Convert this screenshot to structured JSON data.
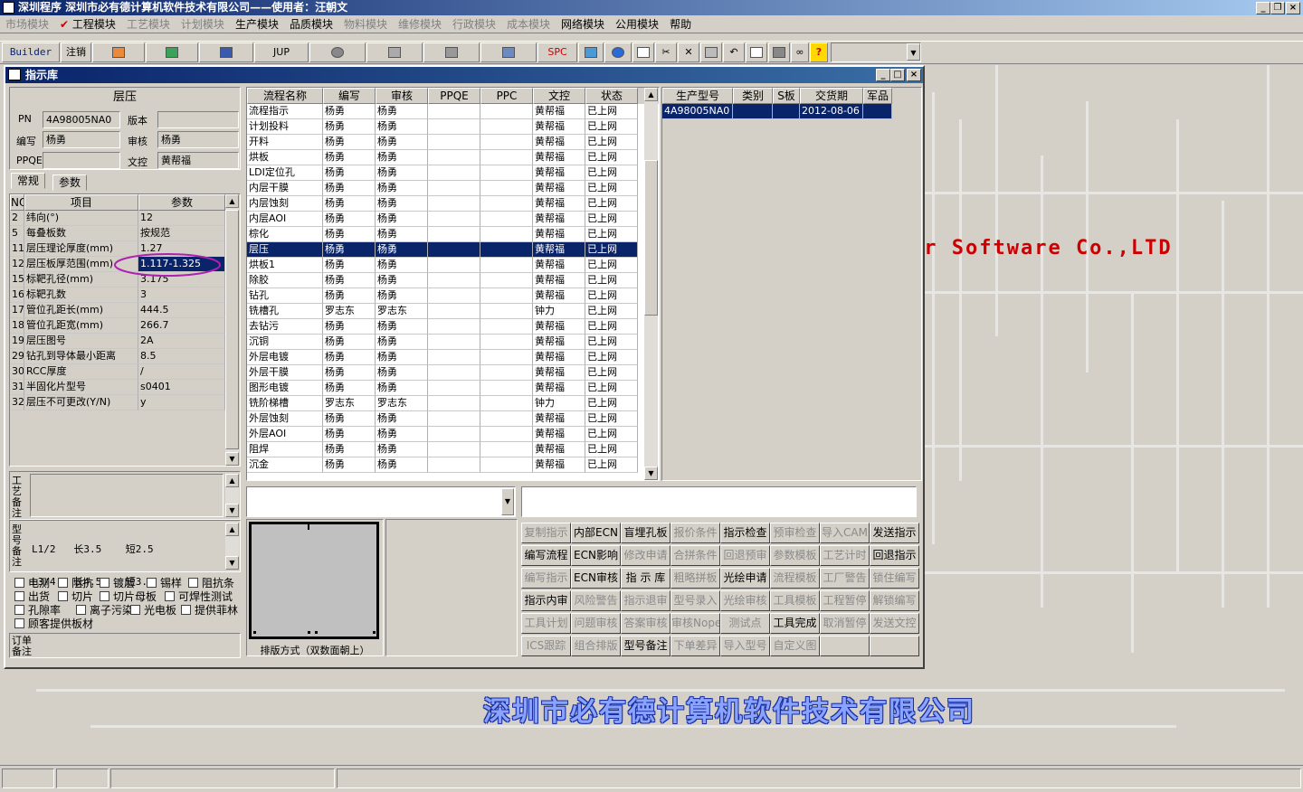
{
  "window": {
    "title": "深圳程序   深圳市必有德计算机软件技术有限公司——使用者：汪朝文"
  },
  "menu": [
    {
      "label": "市场模块",
      "enabled": false
    },
    {
      "label": "工程模块",
      "enabled": true,
      "checked": true
    },
    {
      "label": "工艺模块",
      "enabled": false
    },
    {
      "label": "计划模块",
      "enabled": false
    },
    {
      "label": "生产模块",
      "enabled": true
    },
    {
      "label": "品质模块",
      "enabled": true
    },
    {
      "label": "物料模块",
      "enabled": false
    },
    {
      "label": "维修模块",
      "enabled": false
    },
    {
      "label": "行政模块",
      "enabled": false
    },
    {
      "label": "成本模块",
      "enabled": false
    },
    {
      "label": "网络模块",
      "enabled": true
    },
    {
      "label": "公用模块",
      "enabled": true
    },
    {
      "label": "帮助",
      "enabled": true
    }
  ],
  "toolbar": {
    "builder": "Builder",
    "logout": "注销",
    "jup": "JUP",
    "spc": "SPC"
  },
  "background": {
    "brand_en": "er Software Co.,LTD",
    "brand_cn": "深圳市必有德计算机软件技术有限公司"
  },
  "child": {
    "title": "指示库"
  },
  "info": {
    "process_name": "层压",
    "pn_label": "PN",
    "pn_value": "4A98005NA0",
    "version_label": "版本",
    "version_value": "",
    "editor_label": "编写",
    "editor_value": "杨勇",
    "reviewer_label": "审核",
    "reviewer_value": "杨勇",
    "ppqe_label": "PPQE",
    "ppqe_value": "",
    "doc_label": "文控",
    "doc_value": "黄帮福"
  },
  "tabs": [
    "常规",
    "参数"
  ],
  "params": {
    "headers": [
      "NO",
      "项目",
      "参数"
    ],
    "rows": [
      [
        "2",
        "纬向(°)",
        "12"
      ],
      [
        "5",
        "每叠板数",
        "按规范"
      ],
      [
        "11",
        "层压理论厚度(mm)",
        "1.27"
      ],
      [
        "12",
        "层压板厚范围(mm)",
        "1.117-1.325"
      ],
      [
        "15",
        "标靶孔径(mm)",
        "3.175"
      ],
      [
        "16",
        "标靶孔数",
        "3"
      ],
      [
        "17",
        "管位孔距长(mm)",
        "444.5"
      ],
      [
        "18",
        "管位孔距宽(mm)",
        "266.7"
      ],
      [
        "19",
        "层压图号",
        "2A"
      ],
      [
        "29",
        "钻孔到导体最小距离",
        "8.5"
      ],
      [
        "30",
        "RCC厚度",
        "/"
      ],
      [
        "31",
        "半固化片型号",
        "s0401"
      ],
      [
        "32",
        "层压不可更改(Y/N)",
        "y"
      ]
    ]
  },
  "remarks": {
    "process_label": "工艺备注",
    "model_label": "型号备注",
    "model_text": [
      "L1/2   长3.5    短2.5",
      "L3/4   长4.5    短3.5"
    ],
    "order_label": "订单备注"
  },
  "checkboxes": [
    [
      "电测",
      "阻抗",
      "镀层",
      "锡样",
      "阻抗条"
    ],
    [
      "出货",
      "切片",
      "切片母板",
      "可焊性测试"
    ],
    [
      "孔隙率",
      "离子污染",
      "光电板",
      "提供菲林"
    ],
    [
      "顾客提供板材"
    ]
  ],
  "flows": {
    "headers": [
      "流程名称",
      "编写",
      "审核",
      "PPQE",
      "PPC",
      "文控",
      "状态"
    ],
    "rows": [
      [
        "流程指示",
        "杨勇",
        "杨勇",
        "",
        "",
        "黄帮福",
        "已上网"
      ],
      [
        "计划投料",
        "杨勇",
        "杨勇",
        "",
        "",
        "黄帮福",
        "已上网"
      ],
      [
        "开料",
        "杨勇",
        "杨勇",
        "",
        "",
        "黄帮福",
        "已上网"
      ],
      [
        "烘板",
        "杨勇",
        "杨勇",
        "",
        "",
        "黄帮福",
        "已上网"
      ],
      [
        "LDI定位孔",
        "杨勇",
        "杨勇",
        "",
        "",
        "黄帮福",
        "已上网"
      ],
      [
        "内层干膜",
        "杨勇",
        "杨勇",
        "",
        "",
        "黄帮福",
        "已上网"
      ],
      [
        "内层蚀刻",
        "杨勇",
        "杨勇",
        "",
        "",
        "黄帮福",
        "已上网"
      ],
      [
        "内层AOI",
        "杨勇",
        "杨勇",
        "",
        "",
        "黄帮福",
        "已上网"
      ],
      [
        "棕化",
        "杨勇",
        "杨勇",
        "",
        "",
        "黄帮福",
        "已上网"
      ],
      [
        "层压",
        "杨勇",
        "杨勇",
        "",
        "",
        "黄帮福",
        "已上网"
      ],
      [
        "烘板1",
        "杨勇",
        "杨勇",
        "",
        "",
        "黄帮福",
        "已上网"
      ],
      [
        "除胶",
        "杨勇",
        "杨勇",
        "",
        "",
        "黄帮福",
        "已上网"
      ],
      [
        "钻孔",
        "杨勇",
        "杨勇",
        "",
        "",
        "黄帮福",
        "已上网"
      ],
      [
        "铣槽孔",
        "罗志东",
        "罗志东",
        "",
        "",
        "钟力",
        "已上网"
      ],
      [
        "去钻污",
        "杨勇",
        "杨勇",
        "",
        "",
        "黄帮福",
        "已上网"
      ],
      [
        "沉铜",
        "杨勇",
        "杨勇",
        "",
        "",
        "黄帮福",
        "已上网"
      ],
      [
        "外层电镀",
        "杨勇",
        "杨勇",
        "",
        "",
        "黄帮福",
        "已上网"
      ],
      [
        "外层干膜",
        "杨勇",
        "杨勇",
        "",
        "",
        "黄帮福",
        "已上网"
      ],
      [
        "图形电镀",
        "杨勇",
        "杨勇",
        "",
        "",
        "黄帮福",
        "已上网"
      ],
      [
        "铣阶梯槽",
        "罗志东",
        "罗志东",
        "",
        "",
        "钟力",
        "已上网"
      ],
      [
        "外层蚀刻",
        "杨勇",
        "杨勇",
        "",
        "",
        "黄帮福",
        "已上网"
      ],
      [
        "外层AOI",
        "杨勇",
        "杨勇",
        "",
        "",
        "黄帮福",
        "已上网"
      ],
      [
        "阻焊",
        "杨勇",
        "杨勇",
        "",
        "",
        "黄帮福",
        "已上网"
      ],
      [
        "沉金",
        "杨勇",
        "杨勇",
        "",
        "",
        "黄帮福",
        "已上网"
      ]
    ],
    "selected": 9
  },
  "production": {
    "headers": [
      "生产型号",
      "类别",
      "S板",
      "交货期",
      "军品"
    ],
    "rows": [
      [
        "4A98005NA0",
        "",
        "",
        "2012-08-06",
        ""
      ]
    ]
  },
  "layout_label": "排版方式（双数面朝上）",
  "buttons": [
    [
      [
        "复制指示",
        false
      ],
      [
        "内部ECN",
        true
      ],
      [
        "盲埋孔板",
        true
      ],
      [
        "报价条件",
        false
      ],
      [
        "指示检查",
        true
      ],
      [
        "预审检查",
        false
      ],
      [
        "导入CAM",
        false
      ],
      [
        "发送指示",
        true
      ]
    ],
    [
      [
        "编写流程",
        true
      ],
      [
        "ECN影响",
        true
      ],
      [
        "修改申请",
        false
      ],
      [
        "合拼条件",
        false
      ],
      [
        "回退预审",
        false
      ],
      [
        "参数模板",
        false
      ],
      [
        "工艺计时",
        false
      ],
      [
        "回退指示",
        true
      ]
    ],
    [
      [
        "编写指示",
        false
      ],
      [
        "ECN审核",
        true
      ],
      [
        "指 示 库",
        true
      ],
      [
        "粗略拼板",
        false
      ],
      [
        "光绘申请",
        true
      ],
      [
        "流程模板",
        false
      ],
      [
        "工厂警告",
        false
      ],
      [
        "锁住编写",
        false
      ]
    ],
    [
      [
        "指示内审",
        true
      ],
      [
        "风险警告",
        false
      ],
      [
        "指示退审",
        false
      ],
      [
        "型号录入",
        false
      ],
      [
        "光绘审核",
        false
      ],
      [
        "工具模板",
        false
      ],
      [
        "工程暂停",
        false
      ],
      [
        "解锁编写",
        false
      ]
    ],
    [
      [
        "工具计划",
        false
      ],
      [
        "问题审核",
        false
      ],
      [
        "答案审核",
        false
      ],
      [
        "审核Nope",
        false
      ],
      [
        "测试点",
        false
      ],
      [
        "工具完成",
        true
      ],
      [
        "取消暂停",
        false
      ],
      [
        "发送文控",
        false
      ]
    ],
    [
      [
        "ICS跟踪",
        false
      ],
      [
        "组合排版",
        false
      ],
      [
        "型号备注",
        true
      ],
      [
        "下单差异",
        false
      ],
      [
        "导入型号",
        false
      ],
      [
        "自定义图",
        false
      ],
      [
        "",
        false
      ],
      [
        "",
        false
      ]
    ]
  ]
}
